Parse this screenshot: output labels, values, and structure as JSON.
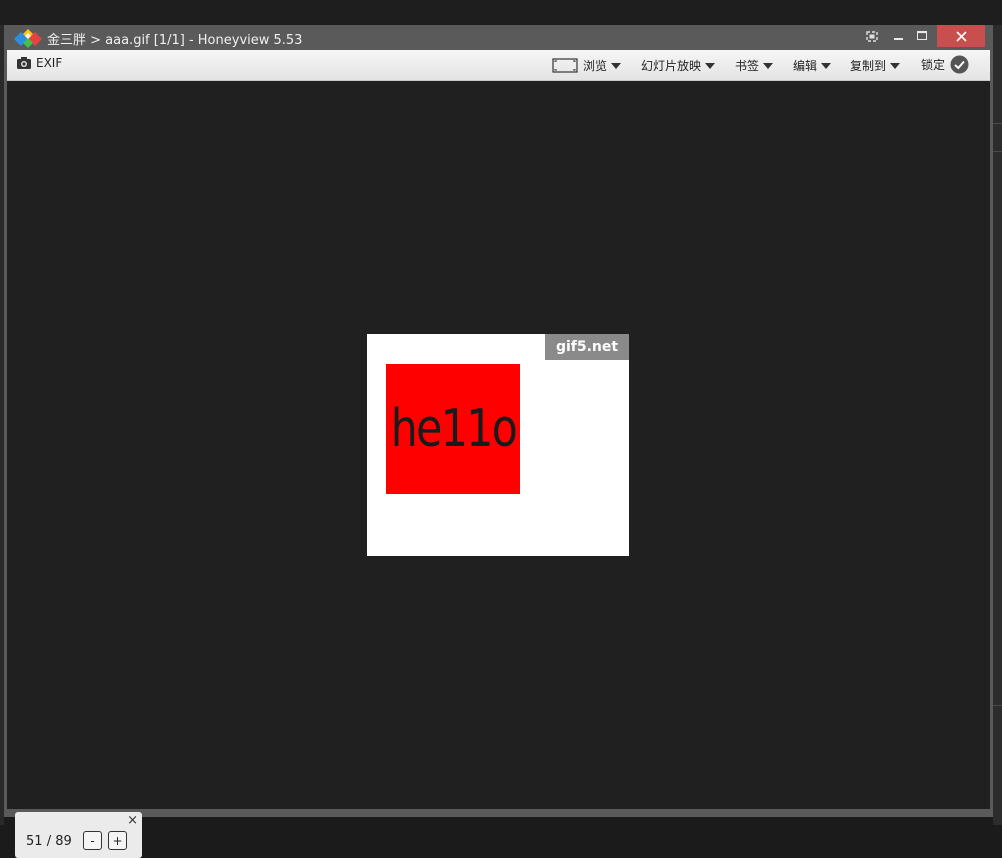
{
  "window": {
    "title": "金三胖 > aaa.gif [1/1] - Honeyview 5.53"
  },
  "toolbar": {
    "exif_label": "EXIF",
    "browse_label": "浏览",
    "slideshow_label": "幻灯片放映",
    "bookmark_label": "书签",
    "edit_label": "编辑",
    "copyto_label": "复制到",
    "lock_label": "锁定"
  },
  "image": {
    "watermark": "gif5.net",
    "text": "he11o",
    "background_color": "#ffffff",
    "box_color": "#ff0000"
  },
  "frame_panel": {
    "current": "51",
    "separator": "/",
    "total": "89",
    "minus_label": "-",
    "plus_label": "+",
    "close_label": "×"
  },
  "colors": {
    "close_button": "#c94f4f",
    "titlebar": "#5a5a5a",
    "viewer_background": "#202020"
  }
}
